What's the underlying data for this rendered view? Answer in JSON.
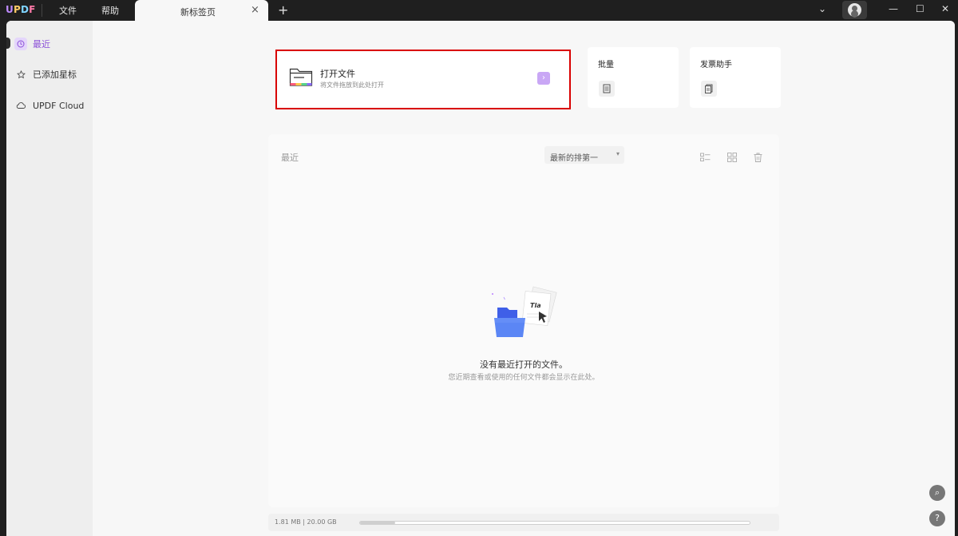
{
  "titlebar": {
    "logo": "UPDF",
    "menu": [
      "文件",
      "帮助"
    ],
    "tab_label": "新标签页",
    "tab_close": "×",
    "new_tab": "+",
    "win_chevron": "⌄",
    "win_minimize": "—",
    "win_maximize": "☐",
    "win_close": "✕"
  },
  "sidebar": {
    "items": [
      {
        "label": "最近",
        "icon": "clock-icon",
        "active": true
      },
      {
        "label": "已添加星标",
        "icon": "star-icon",
        "active": false
      },
      {
        "label": "UPDF Cloud",
        "icon": "cloud-icon",
        "active": false
      }
    ]
  },
  "open_file": {
    "title": "打开文件",
    "subtitle": "将文件拖放到此处打开",
    "arrow": "›"
  },
  "cards": [
    {
      "title": "批量",
      "icon": "batch-icon"
    },
    {
      "title": "发票助手",
      "icon": "invoice-icon"
    }
  ],
  "recent": {
    "label": "最近",
    "sort_label": "最新的排第一",
    "sort_chevron": "▾"
  },
  "empty": {
    "title": "没有最近打开的文件。",
    "subtitle": "您近期查看或使用的任何文件都会显示在此处。",
    "illustration_text": "Tla"
  },
  "footer": {
    "storage": "1.81 MB | 20.00 GB",
    "used_fraction": 0.0905
  },
  "fabs": {
    "search": "⌕",
    "help": "?"
  },
  "colors": {
    "accent": "#8b4fd8",
    "highlight_border": "#d90000",
    "folder_blue": "#4a6cf0"
  }
}
